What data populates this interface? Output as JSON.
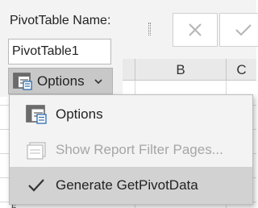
{
  "pivot_panel": {
    "name_label": "PivotTable Name:",
    "name_value": "PivotTable1",
    "options_button_label": "Options"
  },
  "spreadsheet": {
    "columns": [
      "B",
      "C"
    ],
    "partial_row_label": "5"
  },
  "options_menu": {
    "items": [
      {
        "label": "Options",
        "icon": "pivot-options-icon",
        "enabled": true,
        "checked": false
      },
      {
        "label": "Show Report Filter Pages...",
        "icon": "report-filter-pages-icon",
        "enabled": false,
        "checked": false
      },
      {
        "label": "Generate GetPivotData",
        "icon": "checkmark-icon",
        "enabled": true,
        "checked": true,
        "highlighted": true
      }
    ]
  },
  "colors": {
    "panel_bg": "#f3f3f3",
    "button_pressed_bg": "#c8c8c8",
    "menu_highlight_bg": "#d2d2d2",
    "disabled_text": "#a6a6a6"
  }
}
